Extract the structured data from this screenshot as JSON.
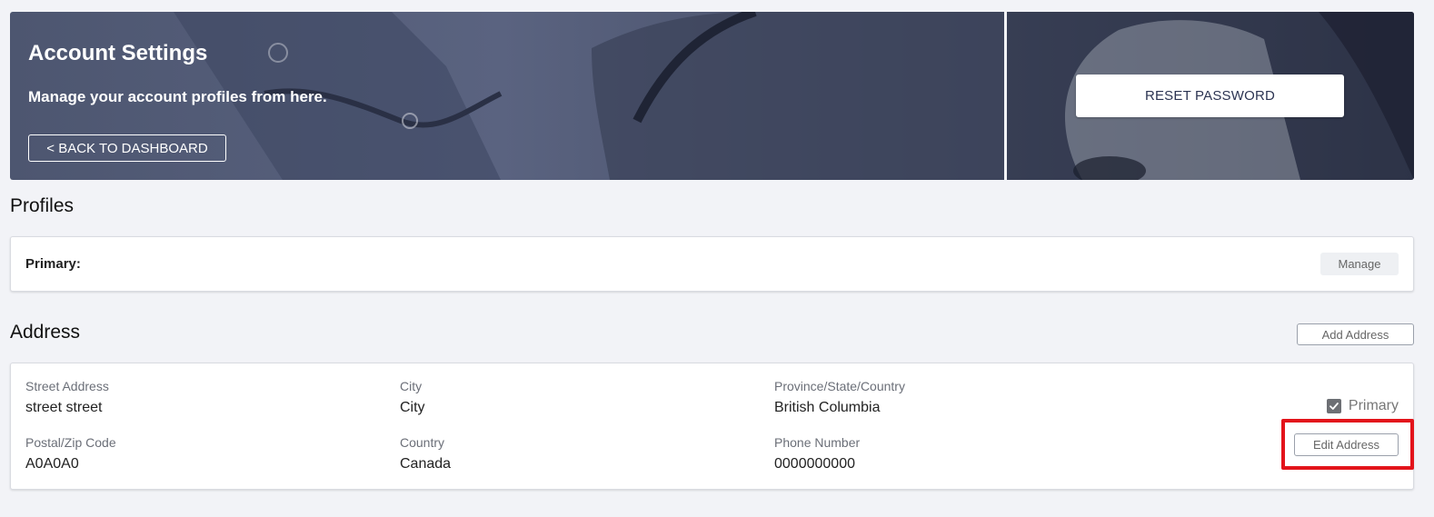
{
  "banner": {
    "title": "Account Settings",
    "subtitle": "Manage your account profiles from here.",
    "back_button": "< BACK TO DASHBOARD",
    "reset_button": "RESET PASSWORD"
  },
  "profiles": {
    "heading": "Profiles",
    "primary_label": "Primary:",
    "manage_button": "Manage"
  },
  "address": {
    "heading": "Address",
    "add_button": "Add Address",
    "fields": [
      {
        "label": "Street Address",
        "value": "street street"
      },
      {
        "label": "City",
        "value": "City"
      },
      {
        "label": "Province/State/Country",
        "value": "British Columbia"
      },
      {
        "label": "Postal/Zip Code",
        "value": "A0A0A0"
      },
      {
        "label": "Country",
        "value": "Canada"
      },
      {
        "label": "Phone Number",
        "value": "0000000000"
      }
    ],
    "primary_checkbox_label": "Primary",
    "primary_checked": true,
    "edit_button": "Edit Address"
  },
  "colors": {
    "highlight": "#e3141b",
    "banner_overlay": "#4d5670",
    "page_background": "#f2f3f7"
  },
  "icons": {
    "checkbox": "check-icon"
  }
}
